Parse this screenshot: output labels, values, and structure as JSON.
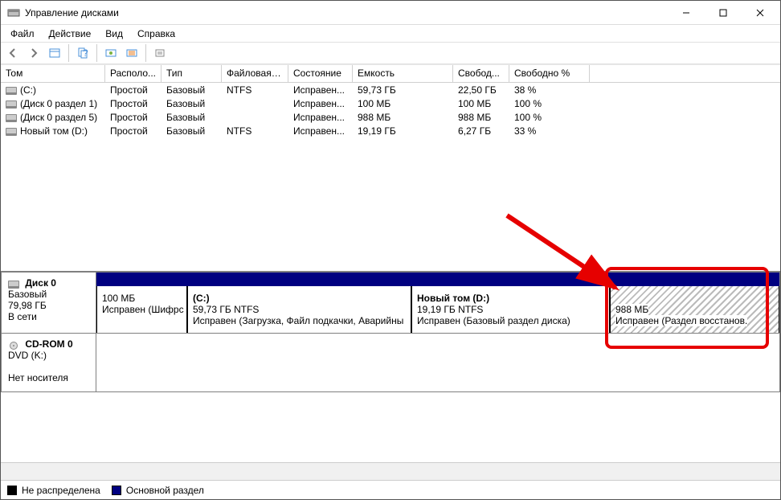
{
  "window": {
    "title": "Управление дисками"
  },
  "menu": {
    "file": "Файл",
    "action": "Действие",
    "view": "Вид",
    "help": "Справка"
  },
  "columns": {
    "c0": "Том",
    "c1": "Располо...",
    "c2": "Тип",
    "c3": "Файловая с...",
    "c4": "Состояние",
    "c5": "Емкость",
    "c6": "Свобод...",
    "c7": "Свободно %"
  },
  "rows": [
    {
      "vol": "(C:)",
      "layout": "Простой",
      "type": "Базовый",
      "fs": "NTFS",
      "status": "Исправен...",
      "cap": "59,73 ГБ",
      "free": "22,50 ГБ",
      "pct": "38 %"
    },
    {
      "vol": "(Диск 0 раздел 1)",
      "layout": "Простой",
      "type": "Базовый",
      "fs": "",
      "status": "Исправен...",
      "cap": "100 МБ",
      "free": "100 МБ",
      "pct": "100 %"
    },
    {
      "vol": "(Диск 0 раздел 5)",
      "layout": "Простой",
      "type": "Базовый",
      "fs": "",
      "status": "Исправен...",
      "cap": "988 МБ",
      "free": "988 МБ",
      "pct": "100 %"
    },
    {
      "vol": "Новый том (D:)",
      "layout": "Простой",
      "type": "Базовый",
      "fs": "NTFS",
      "status": "Исправен...",
      "cap": "19,19 ГБ",
      "free": "6,27 ГБ",
      "pct": "33 %"
    }
  ],
  "disk0": {
    "name": "Диск 0",
    "type": "Базовый",
    "size": "79,98 ГБ",
    "state": "В сети"
  },
  "parts": [
    {
      "title": "",
      "size": "100 МБ",
      "status": "Исправен (Шифрс"
    },
    {
      "title": "(C:)",
      "size": "59,73 ГБ NTFS",
      "status": "Исправен (Загрузка, Файл подкачки, Аварийны"
    },
    {
      "title": "Новый том  (D:)",
      "size": "19,19 ГБ NTFS",
      "status": "Исправен (Базовый раздел диска)"
    },
    {
      "title": "",
      "size": "988 МБ",
      "status": "Исправен (Раздел восстанов."
    }
  ],
  "cdrom": {
    "name": "CD-ROM 0",
    "sub": "DVD (K:)",
    "state": "Нет носителя"
  },
  "legend": {
    "unalloc": "Не распределена",
    "primary": "Основной раздел"
  }
}
